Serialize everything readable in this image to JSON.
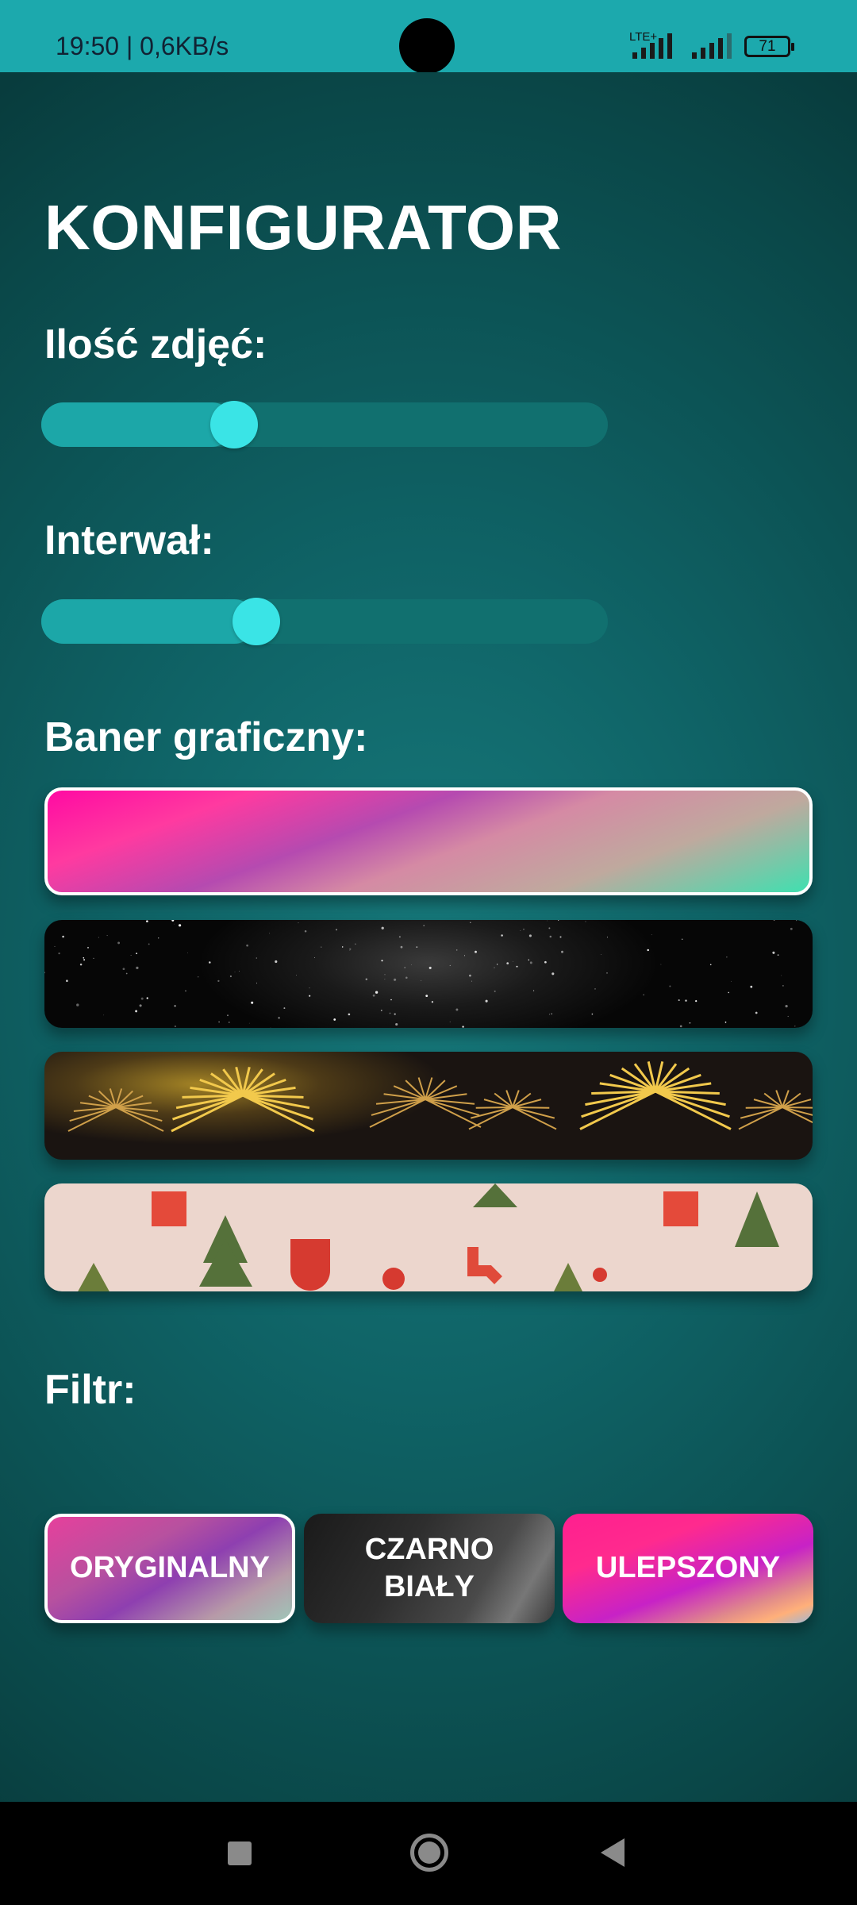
{
  "status_bar": {
    "time": "19:50 | 0,6KB/s",
    "network": "LTE+",
    "battery": "71"
  },
  "screen": {
    "title": "KONFIGURATOR",
    "photos_label": "Ilość zdjęć:",
    "photos_slider_value": 0.34,
    "interval_label": "Interwał:",
    "interval_slider_value": 0.38,
    "banner_label": "Baner graficzny:",
    "banners": [
      {
        "name": "gradient",
        "selected": true
      },
      {
        "name": "starry-night",
        "selected": false
      },
      {
        "name": "fireworks",
        "selected": false
      },
      {
        "name": "christmas-pattern",
        "selected": false
      }
    ],
    "filter_label": "Filtr:",
    "filters": [
      {
        "label": "ORYGINALNY",
        "selected": true
      },
      {
        "label": "CZARNO\nBIAŁY",
        "selected": false
      },
      {
        "label": "ULEPSZONY",
        "selected": false
      }
    ]
  },
  "colors": {
    "status_bar": "#1ca9ad",
    "background": "#0f6366",
    "slider_track": "#11706f",
    "slider_fill": "#1ca7a8",
    "slider_thumb": "#3ae4e6"
  },
  "nav_icons": [
    "recent-apps-icon",
    "home-icon",
    "back-icon"
  ]
}
